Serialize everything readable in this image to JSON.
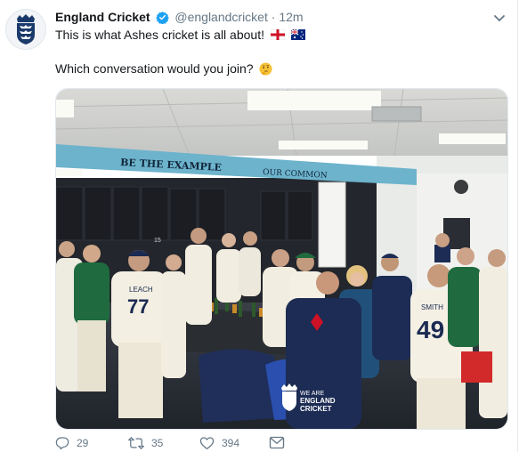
{
  "tweet": {
    "display_name": "England Cricket",
    "handle": "@englandcricket",
    "separator": "·",
    "time": "12m",
    "line1": "This is what Ashes cricket is all about!",
    "line2": "Which conversation would you join?",
    "emoji": [
      "england-flag",
      "australia-flag",
      "thinking-face"
    ]
  },
  "photo": {
    "banner_left": "BE THE EXAMPLE",
    "banner_right": "OUR COMMON",
    "shirt_leach_name": "LEACH",
    "shirt_leach_number": "77",
    "shirt_smith_name": "SMITH",
    "shirt_smith_number": "49",
    "watermark_line1": "WE ARE",
    "watermark_line2": "ENGLAND",
    "watermark_line3": "CRICKET",
    "locker_number": "15"
  },
  "actions": {
    "reply_count": "29",
    "retweet_count": "35",
    "like_count": "394"
  },
  "colors": {
    "accent": "#1da1f2",
    "muted": "#657786",
    "banner": "#6db3cc"
  }
}
